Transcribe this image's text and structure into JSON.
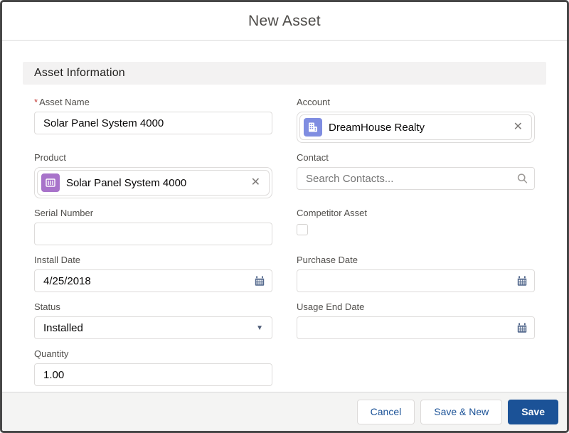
{
  "modal": {
    "title": "New Asset"
  },
  "section": {
    "title": "Asset Information"
  },
  "fields": {
    "asset_name": {
      "label": "Asset Name",
      "required": true,
      "value": "Solar Panel System 4000"
    },
    "account": {
      "label": "Account",
      "value": "DreamHouse Realty",
      "icon": "account-icon",
      "clear_icon": "✕"
    },
    "product": {
      "label": "Product",
      "value": "Solar Panel System 4000",
      "icon": "product-icon",
      "clear_icon": "✕"
    },
    "contact": {
      "label": "Contact",
      "value": "",
      "placeholder": "Search Contacts...",
      "icon": "search-icon"
    },
    "serial_number": {
      "label": "Serial Number",
      "value": ""
    },
    "competitor_asset": {
      "label": "Competitor Asset",
      "checked": false
    },
    "install_date": {
      "label": "Install Date",
      "value": "4/25/2018",
      "icon": "calendar-icon"
    },
    "purchase_date": {
      "label": "Purchase Date",
      "value": "",
      "icon": "calendar-icon"
    },
    "status": {
      "label": "Status",
      "value": "Installed",
      "icon": "chevron-down-icon",
      "arrow": "▼"
    },
    "usage_end_date": {
      "label": "Usage End Date",
      "value": "",
      "icon": "calendar-icon"
    },
    "quantity": {
      "label": "Quantity",
      "value": "1.00"
    }
  },
  "footer": {
    "cancel_label": "Cancel",
    "save_new_label": "Save & New",
    "save_label": "Save"
  },
  "colors": {
    "accent": "#1b5297",
    "account_icon_bg": "#7f8de1",
    "product_icon_bg": "#a873ca",
    "required_asterisk": "#c23934",
    "section_bg": "#f3f2f2",
    "calendar_icon": "#54698d"
  }
}
